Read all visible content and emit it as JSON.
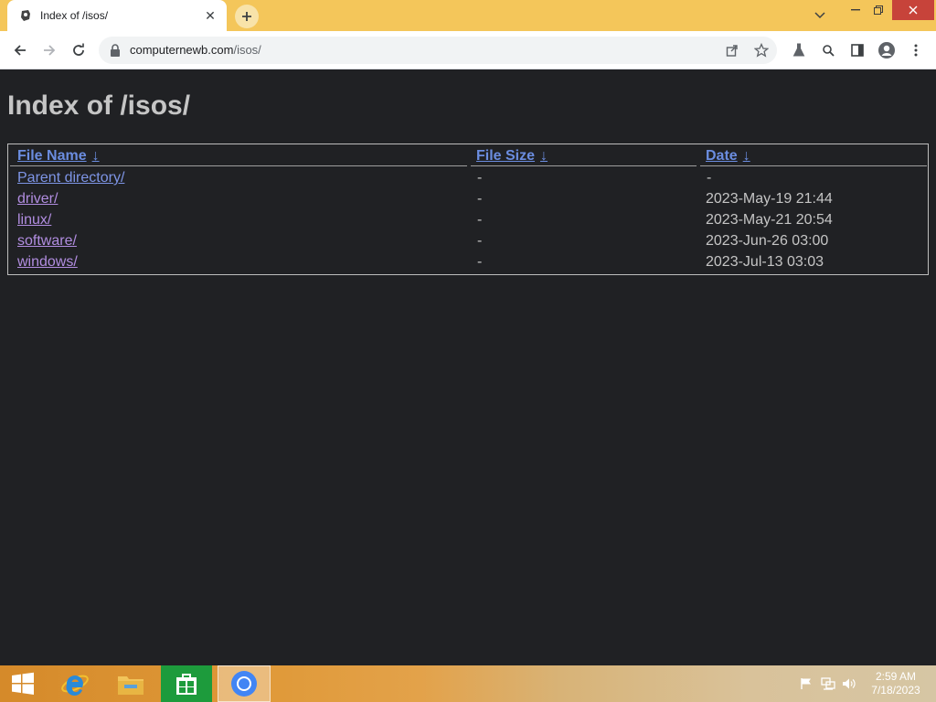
{
  "browser": {
    "tab": {
      "title": "Index of /isos/"
    },
    "address_bar": {
      "host": "computernewb.com",
      "path": "/isos/"
    }
  },
  "page": {
    "heading": "Index of /isos/",
    "table": {
      "headers": [
        {
          "label": "File Name",
          "sort_arrow": "↓"
        },
        {
          "label": "File Size",
          "sort_arrow": "↓"
        },
        {
          "label": "Date",
          "sort_arrow": "↓"
        }
      ],
      "rows": [
        {
          "name": "Parent directory/",
          "size": "-",
          "date": "-"
        },
        {
          "name": "driver/",
          "size": "-",
          "date": "2023-May-19 21:44"
        },
        {
          "name": "linux/",
          "size": "-",
          "date": "2023-May-21 20:54"
        },
        {
          "name": "software/",
          "size": "-",
          "date": "2023-Jun-26 03:00"
        },
        {
          "name": "windows/",
          "size": "-",
          "date": "2023-Jul-13 03:03"
        }
      ]
    }
  },
  "taskbar": {
    "apps": [
      {
        "name": "start",
        "icon": "windows-logo-icon"
      },
      {
        "name": "internet-explorer",
        "icon": "ie-icon"
      },
      {
        "name": "file-explorer",
        "icon": "folder-icon"
      },
      {
        "name": "store",
        "icon": "store-icon"
      },
      {
        "name": "chrome",
        "icon": "chrome-icon",
        "active": true
      }
    ],
    "clock": {
      "time": "2:59 AM",
      "date": "7/18/2023"
    }
  },
  "colors": {
    "titlebar": "#f4c65a",
    "page_background": "#202124",
    "link": "#7e95e6",
    "visited_link": "#b18de0",
    "text": "#c5c5c5"
  }
}
